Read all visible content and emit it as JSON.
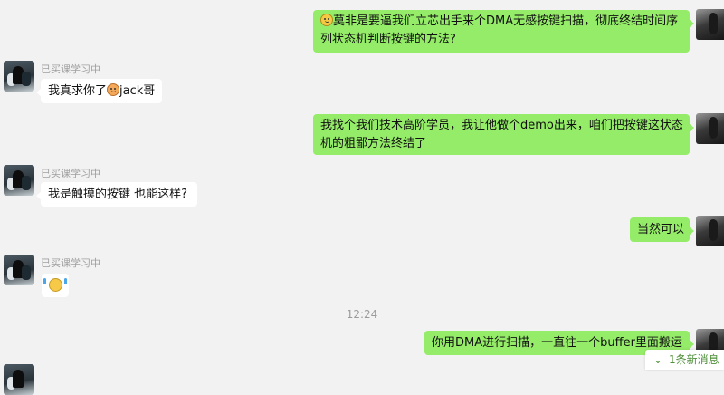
{
  "messages": [
    {
      "direction": "out",
      "emoji": "cat-face-icon",
      "lines": [
        "莫非是要逼我们立芯出手来个DMA无感按键扫描，彻底终结时间序",
        "列状态机判断按键的方法?"
      ]
    },
    {
      "direction": "in",
      "sender": "已买课学习中",
      "text_before": "我真求你了",
      "emoji": "shy-face-icon",
      "text_after": "jack哥"
    },
    {
      "direction": "out",
      "lines": [
        "我找个我们技术高阶学员，我让他做个demo出来，咱们把按键这状态",
        "机的粗鄙方法终结了"
      ]
    },
    {
      "direction": "in",
      "sender": "已买课学习中",
      "text": "我是触摸的按键 也能这样?"
    },
    {
      "direction": "out",
      "text": "当然可以"
    },
    {
      "direction": "in",
      "sender": "已买课学习中",
      "sticker": "crying-face-icon"
    },
    {
      "direction": "out",
      "text": "你用DMA进行扫描，一直往一个buffer里面搬运"
    }
  ],
  "timestamp": "12:24",
  "new_message_indicator": {
    "label": "1条新消息",
    "icon": "chevron-down-icon"
  },
  "colors": {
    "outgoing_bubble": "#95ec69",
    "incoming_bubble": "#ffffff",
    "background": "#f2f2f2"
  }
}
